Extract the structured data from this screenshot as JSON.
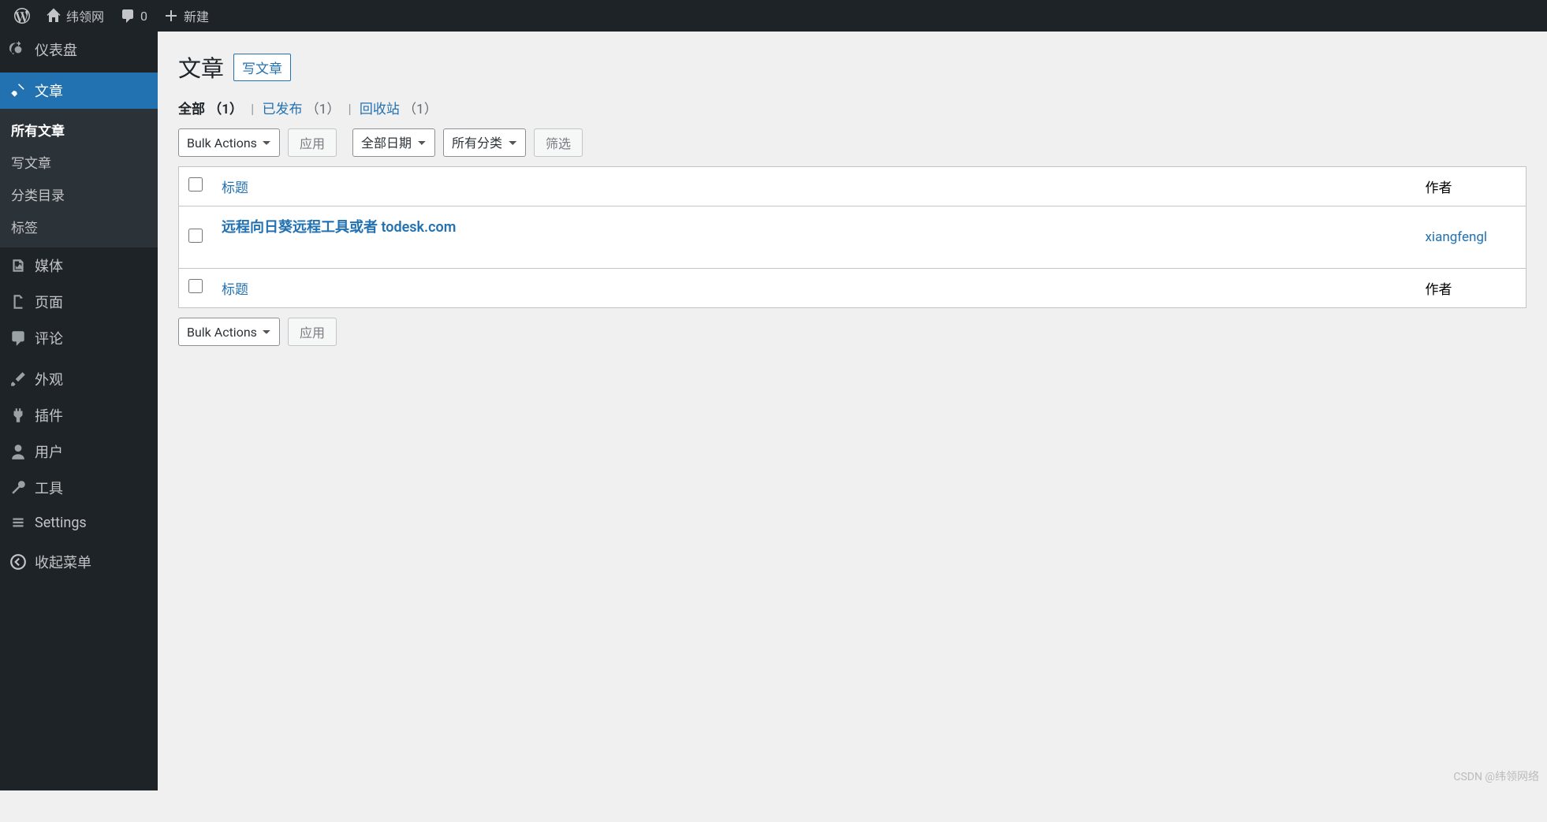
{
  "adminbar": {
    "site_name": "纬领网",
    "comments_count": "0",
    "new_label": "新建"
  },
  "sidebar": {
    "dashboard": "仪表盘",
    "posts": "文章",
    "posts_sub": {
      "all": "所有文章",
      "new": "写文章",
      "categories": "分类目录",
      "tags": "标签"
    },
    "media": "媒体",
    "pages": "页面",
    "comments": "评论",
    "appearance": "外观",
    "plugins": "插件",
    "users": "用户",
    "tools": "工具",
    "settings": "Settings",
    "collapse": "收起菜单"
  },
  "page": {
    "title": "文章",
    "new_post_btn": "写文章"
  },
  "filters": {
    "all_label": "全部",
    "all_count": "（1）",
    "published_label": "已发布",
    "published_count": "（1）",
    "trash_label": "回收站",
    "trash_count": "（1）",
    "separator": "|"
  },
  "controls": {
    "bulk_actions": "Bulk Actions",
    "apply": "应用",
    "all_dates": "全部日期",
    "all_categories": "所有分类",
    "filter": "筛选"
  },
  "table": {
    "col_title": "标题",
    "col_author": "作者",
    "rows": [
      {
        "title": "远程向日葵远程工具或者 todesk.com",
        "author": "xiangfengl"
      }
    ]
  },
  "watermark": "CSDN @纬领网络"
}
